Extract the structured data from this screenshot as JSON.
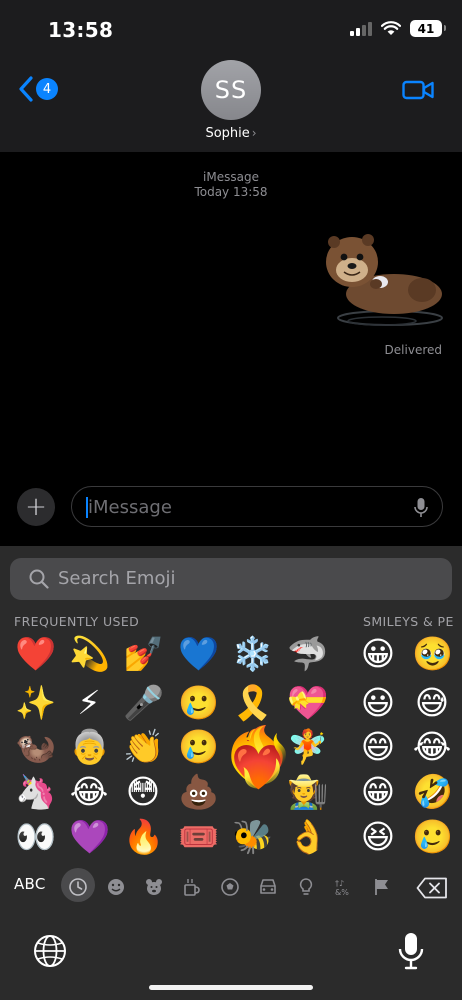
{
  "status": {
    "time": "13:58",
    "battery": "41"
  },
  "nav": {
    "back_badge": "4",
    "avatar_initials": "SS",
    "contact_name": "Sophie"
  },
  "conversation": {
    "service": "iMessage",
    "timestamp": "Today 13:58",
    "sticker": "sea-otter-sticker",
    "delivery_status": "Delivered"
  },
  "composer": {
    "placeholder": "iMessage"
  },
  "emoji_keyboard": {
    "search_placeholder": "Search Emoji",
    "section_frequent": "FREQUENTLY USED",
    "section_smileys": "SMILEYS & PE",
    "frequent": [
      [
        "❤️",
        "💫",
        "💅",
        "💙",
        "❄️",
        "🦈"
      ],
      [
        "✨",
        "⚡",
        "🎤",
        "🥲",
        "🎗️",
        "💝"
      ],
      [
        "🦦",
        "👵",
        "👏",
        "🥲",
        "❤️‍🔥",
        "🧚"
      ],
      [
        "🦄",
        "😂",
        "😳",
        "💩",
        "",
        "🧑‍🌾"
      ],
      [
        "👀",
        "💜",
        "🔥",
        "🎟️",
        "🐝",
        "👌"
      ]
    ],
    "frequent_popped": "❤️‍🔥",
    "smileys": [
      [
        "😀",
        "🥹"
      ],
      [
        "😃",
        "😅"
      ],
      [
        "😄",
        "😂"
      ],
      [
        "😁",
        "🤣"
      ],
      [
        "😆",
        "🥲"
      ]
    ],
    "abc_label": "ABC",
    "categories": [
      "recent",
      "smileys",
      "animals",
      "food",
      "activity",
      "travel",
      "objects",
      "symbols",
      "flags"
    ]
  },
  "colors": {
    "accent": "#0a84ff",
    "keyboard_bg": "#2b2b2b",
    "header_bg": "#1c1c1e"
  }
}
